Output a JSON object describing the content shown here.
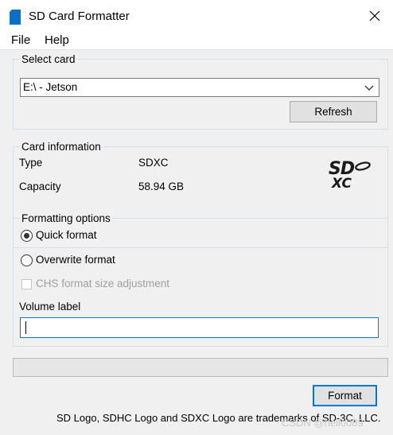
{
  "window": {
    "title": "SD Card Formatter"
  },
  "menu": [
    "File",
    "Help"
  ],
  "select_card": {
    "legend": "Select card",
    "selected": "E:\\ - Jetson",
    "refresh_label": "Refresh"
  },
  "card_info": {
    "legend": "Card information",
    "type_label": "Type",
    "type_value": "SDXC",
    "capacity_label": "Capacity",
    "capacity_value": "58.94 GB",
    "logo": "sdxc-logo"
  },
  "formatting": {
    "legend": "Formatting options",
    "quick_label": "Quick format",
    "quick_selected": true,
    "overwrite_label": "Overwrite format",
    "overwrite_selected": false,
    "chs_label": "CHS format size adjustment",
    "chs_checked": false,
    "chs_enabled": false,
    "volume_label_title": "Volume label",
    "volume_label_value": ""
  },
  "progress": 0,
  "format_label": "Format",
  "footer": "SD Logo, SDHC Logo and SDXC Logo are trademarks of SD-3C, LLC.",
  "watermark": "CSDN @hello089",
  "colors": {
    "accent": "#0078d7",
    "icon": "#0b6fc4"
  }
}
